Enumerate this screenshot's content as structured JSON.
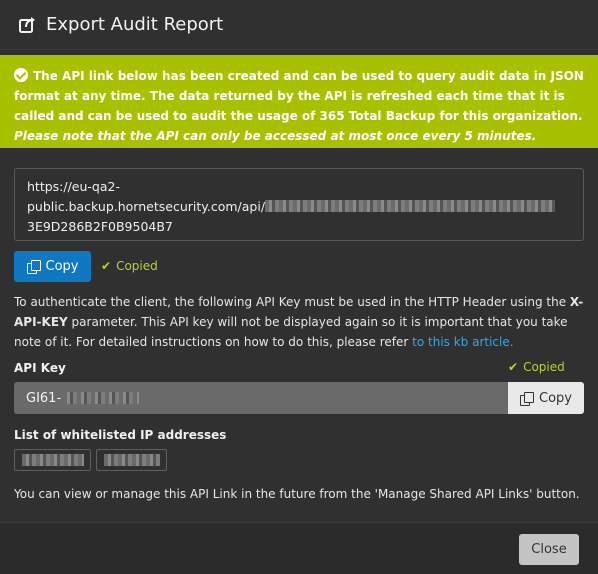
{
  "dialog": {
    "title": "Export Audit Report",
    "icon": "share-export-icon"
  },
  "alert": {
    "text_bold": "The API link below has been created and can be used to query audit data in JSON format at any time. The data returned by the API is refreshed each time that it is called and can be used to audit the usage of 365 Total Backup for this organization.",
    "text_italic": "Please note that the API can only be accessed at most once every 5 minutes.",
    "color": "#a7c000"
  },
  "api_link": {
    "line1": "https://eu-qa2-",
    "line2_prefix": "public.backup.hornetsecurity.com/api/",
    "line3": "3E9D286B2F0B9504B7",
    "copy_label": "Copy",
    "copied_label": "Copied"
  },
  "instructions": {
    "text_a": "To authenticate the client, the following API Key must be used in the HTTP Header using the ",
    "header_name": "X-API-KEY",
    "text_b": " parameter. This API key will not be displayed again so it is important that you take note of it. For detailed instructions on how to do this, please refer ",
    "link_text": "to this kb article."
  },
  "api_key": {
    "label": "API Key",
    "copied_label": "Copied",
    "value_prefix": "GI61-",
    "copy_label": "Copy"
  },
  "whitelist": {
    "label": "List of whitelisted IP addresses"
  },
  "manage_text": "You can view or manage this API Link in the future from the 'Manage Shared API Links' button.",
  "footer": {
    "close_label": "Close"
  },
  "colors": {
    "accent_blue": "#0f78c2",
    "copied_green": "#b9d130",
    "link_blue": "#33a7e6"
  }
}
